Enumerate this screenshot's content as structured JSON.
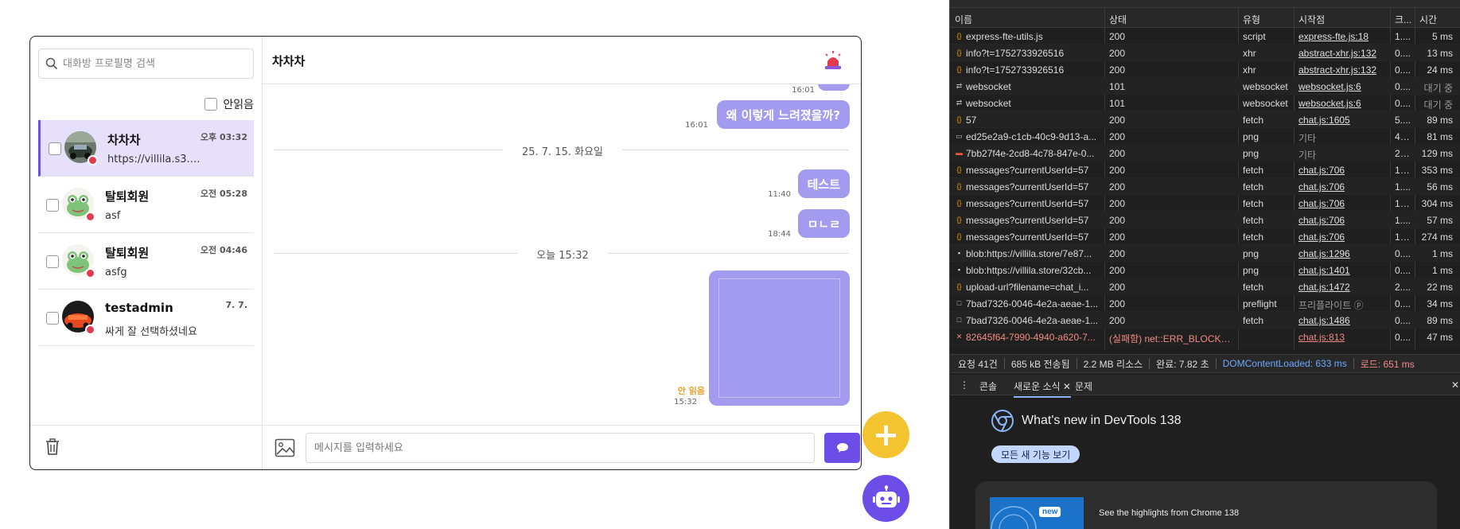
{
  "chat": {
    "search_placeholder": "대화방 프로필명 검색",
    "unread_filter_label": "안읽음",
    "rooms": [
      {
        "name": "차차차",
        "time": "오후 03:32",
        "preview": "https://villila.s3.a..."
      },
      {
        "name": "탈퇴회원",
        "time": "오전 05:28",
        "preview": "asf"
      },
      {
        "name": "탈퇴회원",
        "time": "오전 04:46",
        "preview": "asfg"
      },
      {
        "name": "testadmin",
        "time": "7. 7.",
        "preview": "싸게 잘 선택하셨네요"
      }
    ],
    "header_title": "차차차",
    "messages": {
      "top_time": "16:01",
      "m1_text": "왜 이렇게 느려졌을까?",
      "m1_time": "16:01",
      "date1": "25. 7. 15. 화요일",
      "m2_text": "테스트",
      "m2_time": "11:40",
      "m3_text": "ㅁㄴㄹ",
      "m3_time": "18:44",
      "date2": "오늘 15:32",
      "img_unread": "안 읽음",
      "img_time": "15:32"
    },
    "input_placeholder": "메시지를 입력하세요"
  },
  "fab": {
    "plus_label": "+"
  },
  "devtools": {
    "columns": {
      "name": "이름",
      "status": "상태",
      "type": "유형",
      "initiator": "시작점",
      "size": "크...",
      "time": "시간"
    },
    "rows": [
      {
        "icon": "xhr",
        "name": "express-fte-utils.js",
        "status": "200",
        "type": "script",
        "initiator": "express-fte.js:18",
        "size": "1....",
        "time": "5 ms"
      },
      {
        "icon": "xhr",
        "name": "info?t=1752733926516",
        "status": "200",
        "type": "xhr",
        "initiator": "abstract-xhr.js:132",
        "size": "0....",
        "time": "13 ms"
      },
      {
        "icon": "xhr",
        "name": "info?t=1752733926516",
        "status": "200",
        "type": "xhr",
        "initiator": "abstract-xhr.js:132",
        "size": "0....",
        "time": "24 ms"
      },
      {
        "icon": "ws",
        "name": "websocket",
        "status": "101",
        "type": "websocket",
        "initiator": "websocket.js:6",
        "size": "0....",
        "time": "대기 중"
      },
      {
        "icon": "ws",
        "name": "websocket",
        "status": "101",
        "type": "websocket",
        "initiator": "websocket.js:6",
        "size": "0....",
        "time": "대기 중"
      },
      {
        "icon": "xhr",
        "name": "57",
        "status": "200",
        "type": "fetch",
        "initiator": "chat.js:1605",
        "size": "5....",
        "time": "89 ms"
      },
      {
        "icon": "img",
        "name": "ed25e2a9-c1cb-40c9-9d13-a...",
        "status": "200",
        "type": "png",
        "initiator": "기타",
        "size": "40....",
        "time": "81 ms"
      },
      {
        "icon": "img-red",
        "name": "7bb27f4e-2cd8-4c78-847e-0...",
        "status": "200",
        "type": "png",
        "initiator": "기타",
        "size": "21....",
        "time": "129 ms"
      },
      {
        "icon": "xhr",
        "name": "messages?currentUserId=57",
        "status": "200",
        "type": "fetch",
        "initiator": "chat.js:706",
        "size": "13....",
        "time": "353 ms"
      },
      {
        "icon": "xhr",
        "name": "messages?currentUserId=57",
        "status": "200",
        "type": "fetch",
        "initiator": "chat.js:706",
        "size": "1....",
        "time": "56 ms"
      },
      {
        "icon": "xhr",
        "name": "messages?currentUserId=57",
        "status": "200",
        "type": "fetch",
        "initiator": "chat.js:706",
        "size": "13....",
        "time": "304 ms"
      },
      {
        "icon": "xhr",
        "name": "messages?currentUserId=57",
        "status": "200",
        "type": "fetch",
        "initiator": "chat.js:706",
        "size": "1....",
        "time": "57 ms"
      },
      {
        "icon": "xhr",
        "name": "messages?currentUserId=57",
        "status": "200",
        "type": "fetch",
        "initiator": "chat.js:706",
        "size": "13....",
        "time": "274 ms"
      },
      {
        "icon": "blob",
        "name": "blob:https://villila.store/7e87...",
        "status": "200",
        "type": "png",
        "initiator": "chat.js:1296",
        "size": "0....",
        "time": "1 ms"
      },
      {
        "icon": "blob",
        "name": "blob:https://villila.store/32cb...",
        "status": "200",
        "type": "png",
        "initiator": "chat.js:1401",
        "size": "0....",
        "time": "1 ms"
      },
      {
        "icon": "xhr",
        "name": "upload-url?filename=chat_i...",
        "status": "200",
        "type": "fetch",
        "initiator": "chat.js:1472",
        "size": "2....",
        "time": "22 ms"
      },
      {
        "icon": "doc",
        "name": "7bad7326-0046-4e2a-aeae-1...",
        "status": "200",
        "type": "preflight",
        "initiator": "프리플라이트 ⓟ",
        "size": "0....",
        "time": "34 ms"
      },
      {
        "icon": "doc",
        "name": "7bad7326-0046-4e2a-aeae-1...",
        "status": "200",
        "type": "fetch",
        "initiator": "chat.js:1486",
        "size": "0....",
        "time": "89 ms"
      },
      {
        "icon": "error",
        "name": "82645f64-7990-4940-a620-7...",
        "status": "(실패함) net::ERR_BLOCKED...",
        "type": "",
        "initiator": "chat.js:813",
        "size": "0....",
        "time": "47 ms"
      }
    ],
    "status_bar": {
      "requests": "요청 41건",
      "transferred": "685 kB 전송됨",
      "resources": "2.2 MB 리소스",
      "finish": "완료: 7.82 초",
      "dcl": "DOMContentLoaded: 633 ms",
      "load": "로드: 651 ms"
    },
    "drawer_tabs": {
      "console": "콘솔",
      "whats_new": "새로운 소식",
      "issues": "문제"
    },
    "whats_new_title": "What's new in DevTools 138",
    "all_features_button": "모든 새 기능 보기",
    "card_badge": "new",
    "card_text": "See the highlights from Chrome 138"
  }
}
